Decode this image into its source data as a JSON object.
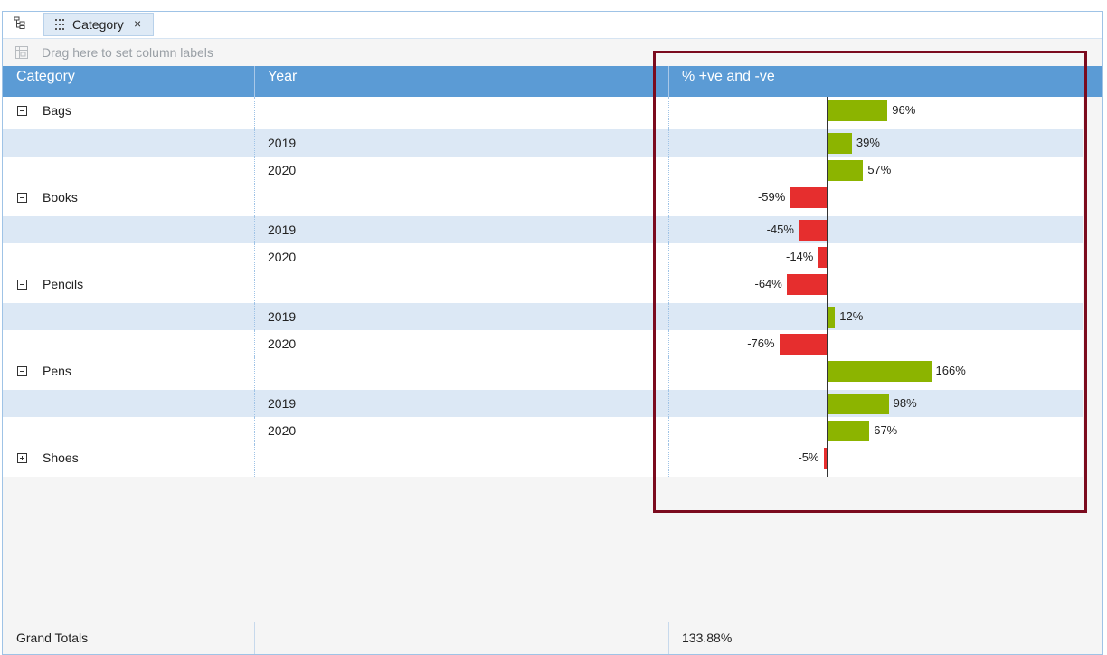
{
  "toolbar": {
    "tree_icon": "tree-hierarchy-icon",
    "chip": {
      "label": "Category",
      "grip_icon": "grid-dots-icon",
      "close_glyph": "×"
    }
  },
  "droparea": {
    "icon": "column-labels-icon",
    "placeholder": "Drag here to set column labels"
  },
  "columns": {
    "category": "Category",
    "year": "Year",
    "value": "% +ve and -ve"
  },
  "rows": [
    {
      "type": "group",
      "category": "Bags",
      "year": "",
      "value": 96,
      "label": "96%",
      "expander": "collapse"
    },
    {
      "type": "detail",
      "category": "",
      "year": "2019",
      "value": 39,
      "label": "39%"
    },
    {
      "type": "detail",
      "category": "",
      "year": "2020",
      "value": 57,
      "label": "57%"
    },
    {
      "type": "group",
      "category": "Books",
      "year": "",
      "value": -59,
      "label": "-59%",
      "expander": "collapse"
    },
    {
      "type": "detail",
      "category": "",
      "year": "2019",
      "value": -45,
      "label": "-45%"
    },
    {
      "type": "detail",
      "category": "",
      "year": "2020",
      "value": -14,
      "label": "-14%"
    },
    {
      "type": "group",
      "category": "Pencils",
      "year": "",
      "value": -64,
      "label": "-64%",
      "expander": "collapse"
    },
    {
      "type": "detail",
      "category": "",
      "year": "2019",
      "value": 12,
      "label": "12%"
    },
    {
      "type": "detail",
      "category": "",
      "year": "2020",
      "value": -76,
      "label": "-76%"
    },
    {
      "type": "group",
      "category": "Pens",
      "year": "",
      "value": 166,
      "label": "166%",
      "expander": "collapse"
    },
    {
      "type": "detail",
      "category": "",
      "year": "2019",
      "value": 98,
      "label": "98%"
    },
    {
      "type": "detail",
      "category": "",
      "year": "2020",
      "value": 67,
      "label": "67%"
    },
    {
      "type": "group",
      "category": "Shoes",
      "year": "",
      "value": -5,
      "label": "-5%",
      "expander": "expand"
    }
  ],
  "totals": {
    "label": "Grand Totals",
    "value": "133.88%"
  },
  "colors": {
    "positive": "#8cb400",
    "negative": "#e62e2e",
    "header": "#5b9bd5",
    "alt_row": "#dce8f5",
    "highlight_border": "#7b0b1e"
  },
  "chart_data": {
    "type": "bar",
    "orientation": "horizontal",
    "categories": [
      "Bags",
      "2019",
      "2020",
      "Books",
      "2019",
      "2020",
      "Pencils",
      "2019",
      "2020",
      "Pens",
      "2019",
      "2020",
      "Shoes"
    ],
    "values": [
      96,
      39,
      57,
      -59,
      -45,
      -14,
      -64,
      12,
      -76,
      166,
      98,
      67,
      -5
    ]
  }
}
